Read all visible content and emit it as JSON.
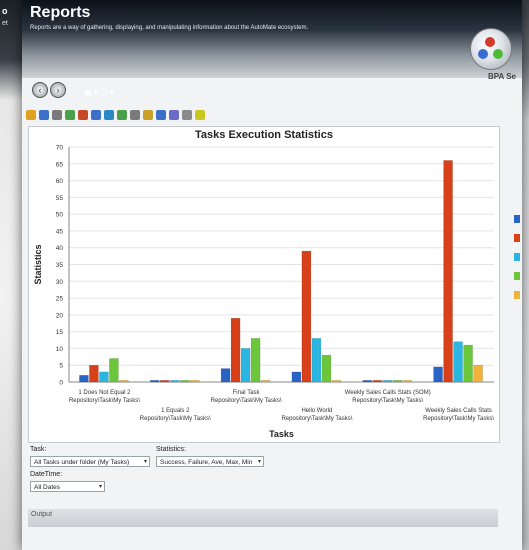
{
  "app": {
    "title": "Reports",
    "subtitle": "Reports are a way of gathering, displaying, and manipulating information about the AutoMate ecosystem.",
    "logo_text": "BPA Se",
    "side_window_title": "o",
    "side_window_sub": "et"
  },
  "toolbar_icons": [
    "bar-chart-icon",
    "print-icon",
    "copy-icon",
    "chart-type-icon",
    "palette-icon",
    "toggle-3d-icon",
    "axis-icon",
    "legend-icon",
    "zoom-icon",
    "rotate-icon",
    "data-grid-icon",
    "series-icon",
    "settings-icon",
    "help-icon"
  ],
  "chart_data": {
    "type": "bar",
    "title": "Tasks Execution Statistics",
    "xlabel": "Tasks",
    "ylabel": "Statistics",
    "ylim": [
      0,
      70
    ],
    "yticks": [
      0,
      5,
      10,
      15,
      20,
      25,
      30,
      35,
      40,
      45,
      50,
      55,
      60,
      65,
      70
    ],
    "categories": [
      "1 Does Not Equal 2\nRepository\\Task\\My Tasks\\",
      "1 Equals 2\nRepository\\Task\\My Tasks\\",
      "Final Task\nRepository\\Task\\My Tasks\\",
      "Hello World\nRepository\\Task\\My Tasks\\",
      "Weekly Sales Calls Stats (SOM)\nRepository\\Task\\My Tasks\\",
      "Weekly Sales Calls Stats\nRepository\\Task\\My Tasks\\"
    ],
    "series": [
      {
        "values": [
          2,
          0.5,
          4,
          3,
          0.5,
          4.5
        ],
        "color": "#2a63c6"
      },
      {
        "values": [
          5,
          0.5,
          19,
          39,
          0.5,
          66
        ],
        "color": "#d8401a"
      },
      {
        "values": [
          3,
          0.5,
          10,
          13,
          0.5,
          12
        ],
        "color": "#2ab6e0"
      },
      {
        "values": [
          7,
          0.5,
          13,
          8,
          0.5,
          11
        ],
        "color": "#6cc63a"
      },
      {
        "values": [
          0.5,
          0.5,
          0.5,
          0.5,
          0.5,
          5
        ],
        "color": "#f0b23a"
      }
    ],
    "grid": true,
    "legend": "right"
  },
  "form": {
    "task_label": "Task:",
    "task_value": "All Tasks under folder (My Tasks)",
    "statistics_label": "Statistics:",
    "statistics_value": "Success, Failure, Ave, Max, Min",
    "datetime_label": "DateTime:",
    "datetime_value": "All Dates",
    "output_label": "Output"
  }
}
